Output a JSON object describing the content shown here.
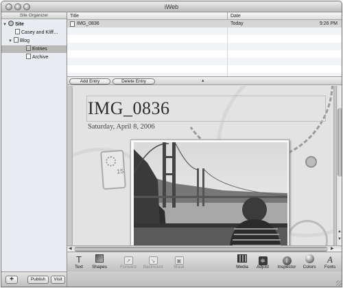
{
  "window": {
    "title": "iWeb"
  },
  "sidebar": {
    "header": "Site Organizer",
    "items": [
      {
        "label": "Site",
        "icon": "globe-icon",
        "disclosure": "▼"
      },
      {
        "label": "Casey and Kliff…",
        "icon": "page-icon"
      },
      {
        "label": "Blog",
        "icon": "page-icon",
        "disclosure": "▼"
      },
      {
        "label": "Entries",
        "icon": "grid-icon",
        "selected": true
      },
      {
        "label": "Archive",
        "icon": "page-icon"
      }
    ]
  },
  "list": {
    "columns": {
      "title": "Title",
      "date": "Date"
    },
    "rows": [
      {
        "title": "IMG_0836",
        "date": "Today",
        "time": "9:26 PM"
      }
    ]
  },
  "entry_buttons": {
    "add": "Add Entry",
    "delete": "Delete Entry",
    "splitter": "▴"
  },
  "page": {
    "title": "IMG_0836",
    "date": "Saturday, April 8, 2006",
    "calendar_text": "15."
  },
  "scroll_arrows": {
    "up": "▲",
    "down": "▼",
    "left": "◀",
    "right": "▶"
  },
  "toolbar": {
    "text": "Text",
    "text_glyph": "T",
    "shapes": "Shapes",
    "forward": "Forward",
    "forward_glyph": "↗",
    "backward": "Backward",
    "backward_glyph": "↘",
    "mask": "Mask",
    "mask_glyph": "▣",
    "media": "Media",
    "adjust": "Adjust",
    "adjust_glyph": "≑",
    "inspector": "Inspector",
    "inspector_glyph": "i",
    "colors": "Colors",
    "fonts": "Fonts",
    "fonts_glyph": "A"
  },
  "bottom": {
    "add_glyph": "+",
    "publish": "Publish",
    "visit": "Visit"
  }
}
